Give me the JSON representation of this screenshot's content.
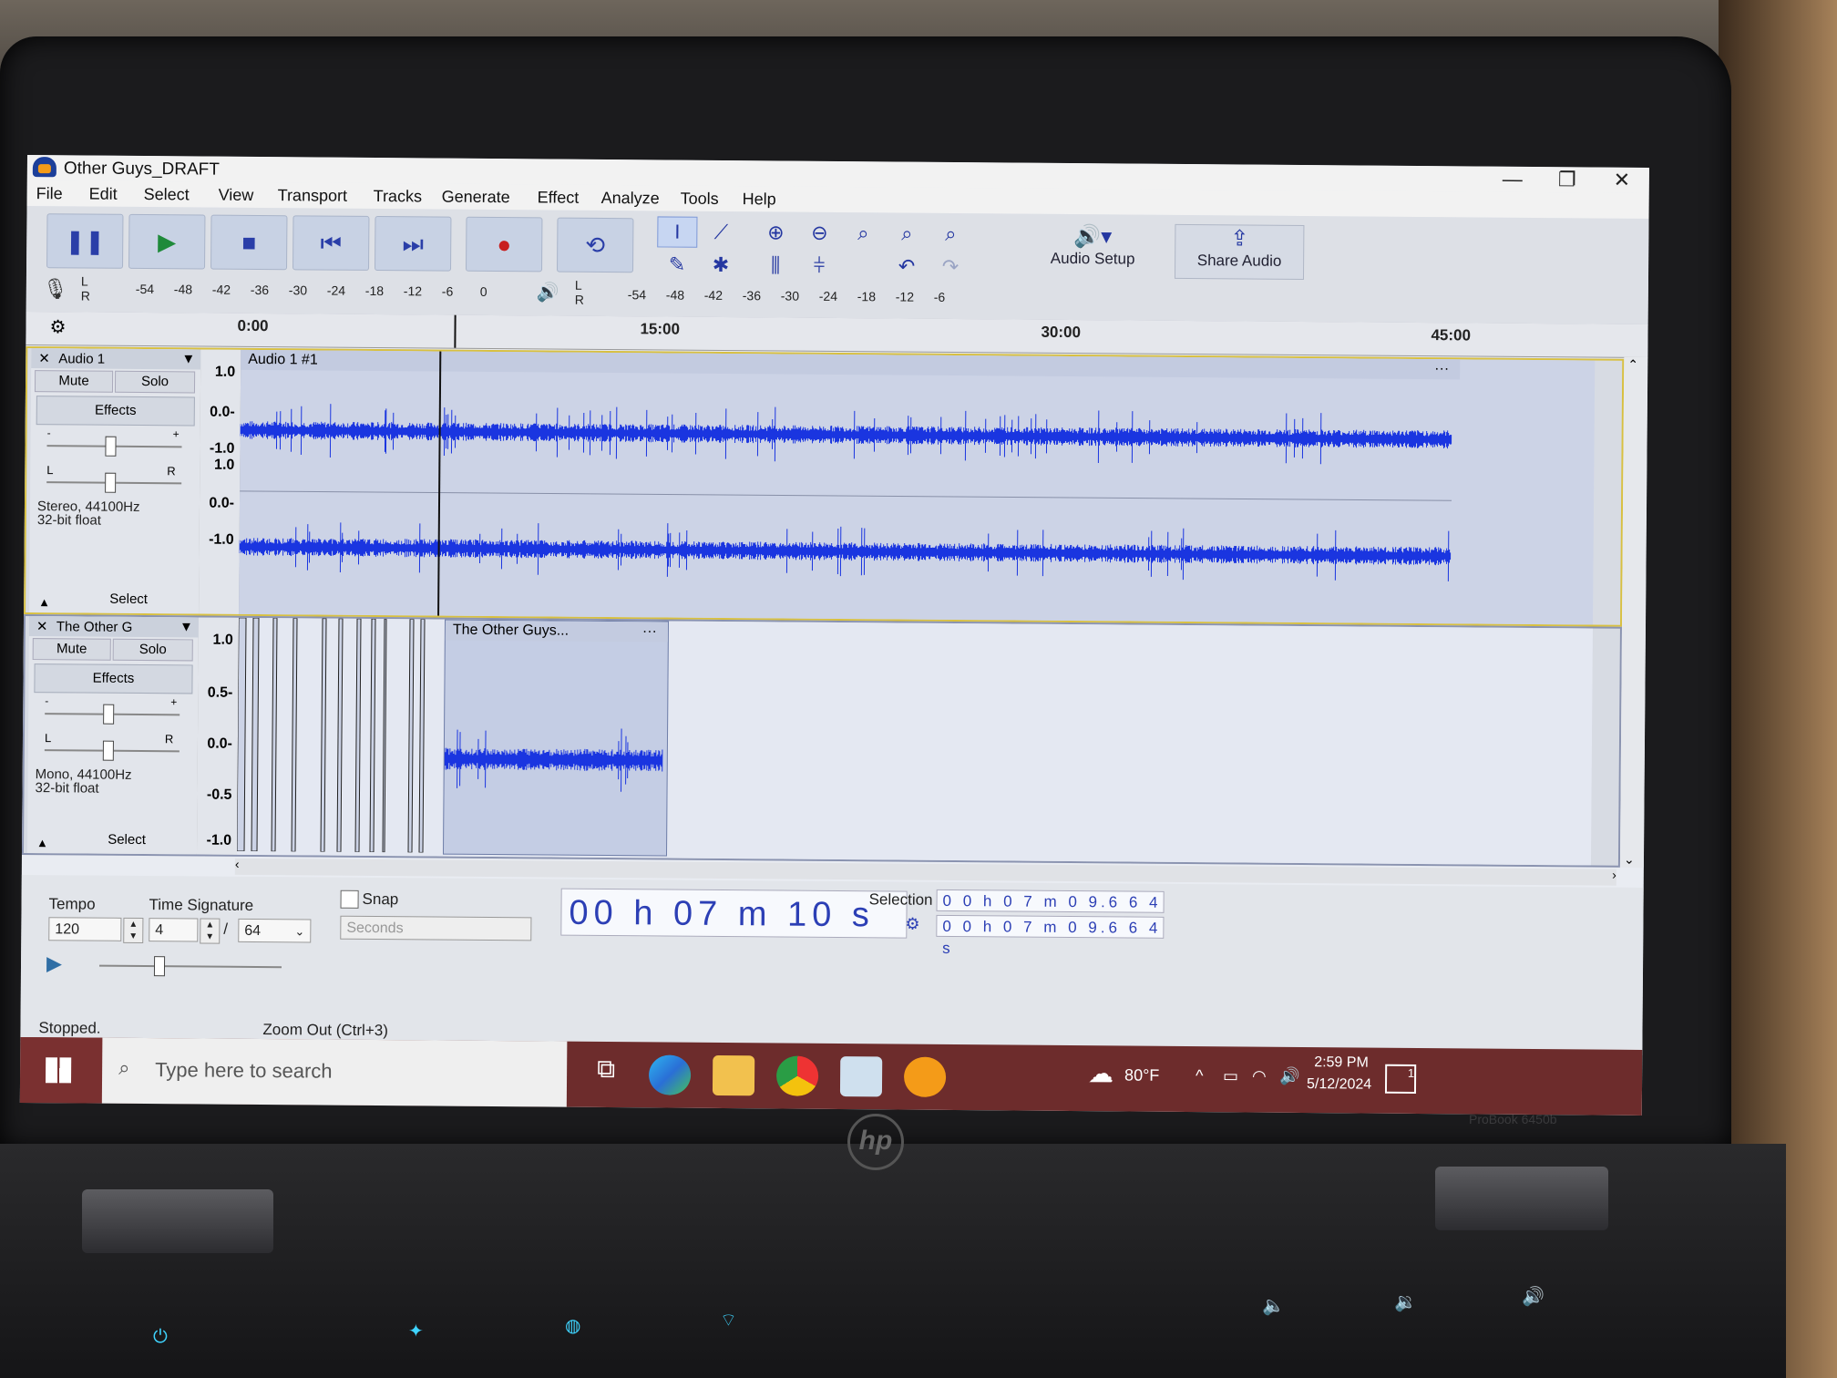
{
  "window": {
    "title": "Other Guys_DRAFT",
    "minimize": "—",
    "restore": "❐",
    "close": "✕"
  },
  "menu": [
    "File",
    "Edit",
    "Select",
    "View",
    "Transport",
    "Tracks",
    "Generate",
    "Effect",
    "Analyze",
    "Tools",
    "Help"
  ],
  "toolbar": {
    "audio_setup": "Audio Setup",
    "share_audio": "Share Audio"
  },
  "meters": {
    "record_ticks": [
      "-54",
      "-48",
      "-42",
      "-36",
      "-30",
      "-24",
      "-18",
      "-12",
      "-6",
      "0"
    ],
    "play_ticks": [
      "-54",
      "-48",
      "-42",
      "-36",
      "-30",
      "-24",
      "-18",
      "-12",
      "-6"
    ],
    "lr": [
      "L",
      "R"
    ]
  },
  "ruler": {
    "ticks": [
      "0:00",
      "15:00",
      "30:00",
      "45:00"
    ]
  },
  "tracks": [
    {
      "name": "Audio 1",
      "mute": "Mute",
      "solo": "Solo",
      "effects": "Effects",
      "info_line1": "Stereo, 44100Hz",
      "info_line2": "32-bit float",
      "select": "Select",
      "clip_name": "Audio 1 #1",
      "scale": [
        "1.0",
        "0.0-",
        "-1.0",
        "1.0",
        "0.0-",
        "-1.0"
      ]
    },
    {
      "name": "The Other G",
      "mute": "Mute",
      "solo": "Solo",
      "effects": "Effects",
      "info_line1": "Mono, 44100Hz",
      "info_line2": "32-bit float",
      "select": "Select",
      "clip_name": "The Other Guys...",
      "scale": [
        "1.0",
        "0.5-",
        "0.0-",
        "-0.5",
        "-1.0"
      ]
    }
  ],
  "pan": {
    "l": "L",
    "r": "R",
    "minus": "-",
    "plus": "+"
  },
  "bottom": {
    "tempo_label": "Tempo",
    "tempo_value": "120",
    "timesig_label": "Time Signature",
    "timesig_num": "4",
    "timesig_slash": "/",
    "timesig_den": "64",
    "snap_label": "Snap",
    "snap_unit": "Seconds",
    "big_time": "00 h 07 m 10 s",
    "selection_label": "Selection",
    "sel_start": "0 0 h 0 7 m 0 9.6 6 4 s",
    "sel_end": "0 0 h 0 7 m 0 9.6 6 4 s"
  },
  "status": {
    "left": "Stopped.",
    "center": "Zoom Out (Ctrl+3)"
  },
  "taskbar": {
    "search_placeholder": "Type here to search",
    "weather": "80°F",
    "time": "2:59 PM",
    "date": "5/12/2024",
    "notif": "1"
  },
  "laptop": {
    "model": "ProBook 6450b",
    "logo": "hp"
  },
  "colors": {
    "waveform": "#1a35e0",
    "accent": "#2c3fb5",
    "taskbar": "#6d2c2c"
  }
}
